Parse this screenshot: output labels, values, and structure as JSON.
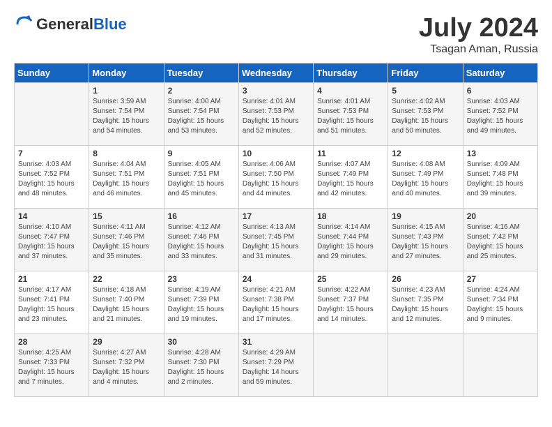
{
  "header": {
    "logo_general": "General",
    "logo_blue": "Blue",
    "month_year": "July 2024",
    "location": "Tsagan Aman, Russia"
  },
  "calendar": {
    "days_of_week": [
      "Sunday",
      "Monday",
      "Tuesday",
      "Wednesday",
      "Thursday",
      "Friday",
      "Saturday"
    ],
    "weeks": [
      [
        {
          "day": "",
          "info": ""
        },
        {
          "day": "1",
          "info": "Sunrise: 3:59 AM\nSunset: 7:54 PM\nDaylight: 15 hours\nand 54 minutes."
        },
        {
          "day": "2",
          "info": "Sunrise: 4:00 AM\nSunset: 7:54 PM\nDaylight: 15 hours\nand 53 minutes."
        },
        {
          "day": "3",
          "info": "Sunrise: 4:01 AM\nSunset: 7:53 PM\nDaylight: 15 hours\nand 52 minutes."
        },
        {
          "day": "4",
          "info": "Sunrise: 4:01 AM\nSunset: 7:53 PM\nDaylight: 15 hours\nand 51 minutes."
        },
        {
          "day": "5",
          "info": "Sunrise: 4:02 AM\nSunset: 7:53 PM\nDaylight: 15 hours\nand 50 minutes."
        },
        {
          "day": "6",
          "info": "Sunrise: 4:03 AM\nSunset: 7:52 PM\nDaylight: 15 hours\nand 49 minutes."
        }
      ],
      [
        {
          "day": "7",
          "info": "Sunrise: 4:03 AM\nSunset: 7:52 PM\nDaylight: 15 hours\nand 48 minutes."
        },
        {
          "day": "8",
          "info": "Sunrise: 4:04 AM\nSunset: 7:51 PM\nDaylight: 15 hours\nand 46 minutes."
        },
        {
          "day": "9",
          "info": "Sunrise: 4:05 AM\nSunset: 7:51 PM\nDaylight: 15 hours\nand 45 minutes."
        },
        {
          "day": "10",
          "info": "Sunrise: 4:06 AM\nSunset: 7:50 PM\nDaylight: 15 hours\nand 44 minutes."
        },
        {
          "day": "11",
          "info": "Sunrise: 4:07 AM\nSunset: 7:49 PM\nDaylight: 15 hours\nand 42 minutes."
        },
        {
          "day": "12",
          "info": "Sunrise: 4:08 AM\nSunset: 7:49 PM\nDaylight: 15 hours\nand 40 minutes."
        },
        {
          "day": "13",
          "info": "Sunrise: 4:09 AM\nSunset: 7:48 PM\nDaylight: 15 hours\nand 39 minutes."
        }
      ],
      [
        {
          "day": "14",
          "info": "Sunrise: 4:10 AM\nSunset: 7:47 PM\nDaylight: 15 hours\nand 37 minutes."
        },
        {
          "day": "15",
          "info": "Sunrise: 4:11 AM\nSunset: 7:46 PM\nDaylight: 15 hours\nand 35 minutes."
        },
        {
          "day": "16",
          "info": "Sunrise: 4:12 AM\nSunset: 7:46 PM\nDaylight: 15 hours\nand 33 minutes."
        },
        {
          "day": "17",
          "info": "Sunrise: 4:13 AM\nSunset: 7:45 PM\nDaylight: 15 hours\nand 31 minutes."
        },
        {
          "day": "18",
          "info": "Sunrise: 4:14 AM\nSunset: 7:44 PM\nDaylight: 15 hours\nand 29 minutes."
        },
        {
          "day": "19",
          "info": "Sunrise: 4:15 AM\nSunset: 7:43 PM\nDaylight: 15 hours\nand 27 minutes."
        },
        {
          "day": "20",
          "info": "Sunrise: 4:16 AM\nSunset: 7:42 PM\nDaylight: 15 hours\nand 25 minutes."
        }
      ],
      [
        {
          "day": "21",
          "info": "Sunrise: 4:17 AM\nSunset: 7:41 PM\nDaylight: 15 hours\nand 23 minutes."
        },
        {
          "day": "22",
          "info": "Sunrise: 4:18 AM\nSunset: 7:40 PM\nDaylight: 15 hours\nand 21 minutes."
        },
        {
          "day": "23",
          "info": "Sunrise: 4:19 AM\nSunset: 7:39 PM\nDaylight: 15 hours\nand 19 minutes."
        },
        {
          "day": "24",
          "info": "Sunrise: 4:21 AM\nSunset: 7:38 PM\nDaylight: 15 hours\nand 17 minutes."
        },
        {
          "day": "25",
          "info": "Sunrise: 4:22 AM\nSunset: 7:37 PM\nDaylight: 15 hours\nand 14 minutes."
        },
        {
          "day": "26",
          "info": "Sunrise: 4:23 AM\nSunset: 7:35 PM\nDaylight: 15 hours\nand 12 minutes."
        },
        {
          "day": "27",
          "info": "Sunrise: 4:24 AM\nSunset: 7:34 PM\nDaylight: 15 hours\nand 9 minutes."
        }
      ],
      [
        {
          "day": "28",
          "info": "Sunrise: 4:25 AM\nSunset: 7:33 PM\nDaylight: 15 hours\nand 7 minutes."
        },
        {
          "day": "29",
          "info": "Sunrise: 4:27 AM\nSunset: 7:32 PM\nDaylight: 15 hours\nand 4 minutes."
        },
        {
          "day": "30",
          "info": "Sunrise: 4:28 AM\nSunset: 7:30 PM\nDaylight: 15 hours\nand 2 minutes."
        },
        {
          "day": "31",
          "info": "Sunrise: 4:29 AM\nSunset: 7:29 PM\nDaylight: 14 hours\nand 59 minutes."
        },
        {
          "day": "",
          "info": ""
        },
        {
          "day": "",
          "info": ""
        },
        {
          "day": "",
          "info": ""
        }
      ]
    ]
  }
}
